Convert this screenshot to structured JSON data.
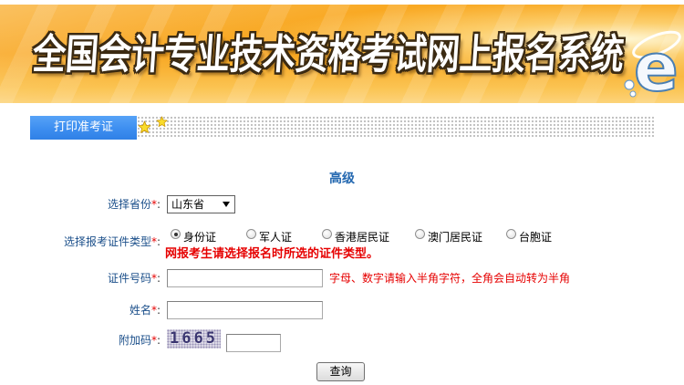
{
  "banner": {
    "title": "全国会计专业技术资格考试网上报名系统",
    "logo_text": "e"
  },
  "nav": {
    "tabs": [
      {
        "label": "打印准考证",
        "active": true
      }
    ]
  },
  "icons": {
    "tab_decoration": "star-icon",
    "select_arrow": "dropdown-arrow-icon",
    "logo": "logo-e-icon"
  },
  "form": {
    "title": "高级",
    "required_mark": "*",
    "colon": ":",
    "province": {
      "label": "选择省份",
      "selected": "山东省"
    },
    "id_type": {
      "label": "选择报考证件类型",
      "options": [
        {
          "label": "身份证",
          "checked": true
        },
        {
          "label": "军人证",
          "checked": false
        },
        {
          "label": "香港居民证",
          "checked": false
        },
        {
          "label": "澳门居民证",
          "checked": false
        },
        {
          "label": "台胞证",
          "checked": false
        }
      ],
      "note": "网报考生请选择报名时所选的证件类型。"
    },
    "id_number": {
      "label": "证件号码",
      "value": "",
      "hint": "字母、数字请输入半角字符，全角会自动转为半角"
    },
    "name": {
      "label": "姓名",
      "value": ""
    },
    "captcha": {
      "label": "附加码",
      "code": "1665",
      "value": ""
    },
    "submit_label": "查询"
  },
  "colors": {
    "banner_orange": "#f8a51d",
    "tab_blue": "#3d8ef0",
    "title_blue": "#2468b0",
    "label_blue": "#1b4f8a",
    "required_red": "#e60000"
  }
}
